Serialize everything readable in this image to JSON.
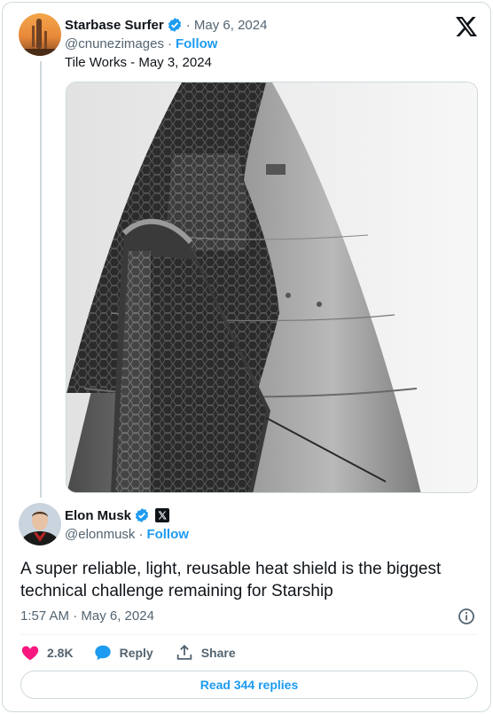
{
  "colors": {
    "accent": "#1d9bf0",
    "like": "#f91880",
    "muted": "#536471",
    "text": "#0f1419",
    "border": "#cfd9de"
  },
  "quoted": {
    "display_name": "Starbase Surfer",
    "date": "· May 6, 2024",
    "handle": "@cnunezimages",
    "separator": "·",
    "follow_label": "Follow",
    "text": "Tile Works - May 3, 2024",
    "avatar_icon": "rocket-avatar",
    "photo_icon": "starship-heat-shield-photo"
  },
  "main": {
    "display_name": "Elon Musk",
    "handle": "@elonmusk",
    "separator": "·",
    "follow_label": "Follow",
    "text": "A super reliable, light, reusable heat shield is the biggest technical challenge remaining for Starship",
    "timestamp": "1:57 AM · May 6, 2024",
    "avatar_icon": "user-avatar"
  },
  "actions": {
    "like_count": "2.8K",
    "reply_label": "Reply",
    "share_label": "Share"
  },
  "read_replies_label": "Read 344 replies",
  "icons": [
    "x-logo-icon",
    "verified-badge-icon",
    "x-affiliate-icon",
    "info-icon",
    "heart-icon",
    "reply-bubble-icon",
    "share-icon"
  ]
}
